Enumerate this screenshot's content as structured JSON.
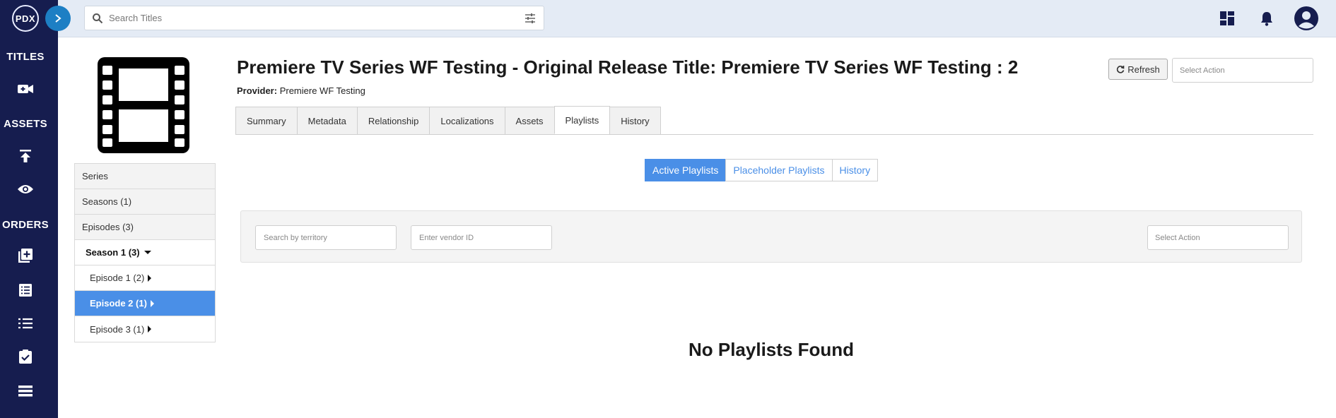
{
  "app": {
    "logo_text": "PDX"
  },
  "sidebar": {
    "sections": [
      {
        "heading": "TITLES"
      },
      {
        "heading": "ASSETS"
      },
      {
        "heading": "ORDERS"
      }
    ],
    "icons": [
      "video-camera-icon",
      "upload-icon",
      "eye-icon",
      "add-library-icon",
      "list-box-icon",
      "numbered-list-icon",
      "clipboard-check-icon",
      "table-list-icon"
    ]
  },
  "topbar": {
    "search_placeholder": "Search Titles",
    "icons": [
      "dashboard-icon",
      "bell-icon",
      "account-icon"
    ]
  },
  "header": {
    "title": "Premiere TV Series WF Testing - Original Release Title: Premiere TV Series WF Testing : 2",
    "provider_label": "Provider:",
    "provider_value": "Premiere WF Testing",
    "refresh_label": "Refresh",
    "select_action_placeholder": "Select Action"
  },
  "tree": {
    "items": [
      {
        "label": "Series"
      },
      {
        "label": "Seasons (1)"
      },
      {
        "label": "Episodes (3)"
      },
      {
        "label": "Season 1 (3)"
      },
      {
        "label": "Episode 1 (2)"
      },
      {
        "label": "Episode 2 (1)"
      },
      {
        "label": "Episode 3 (1)"
      }
    ]
  },
  "tabs": [
    {
      "label": "Summary"
    },
    {
      "label": "Metadata"
    },
    {
      "label": "Relationship"
    },
    {
      "label": "Localizations"
    },
    {
      "label": "Assets"
    },
    {
      "label": "Playlists",
      "active": true
    },
    {
      "label": "History"
    }
  ],
  "playlist_toggle": [
    {
      "label": "Active Playlists",
      "active": true
    },
    {
      "label": "Placeholder Playlists"
    },
    {
      "label": "History"
    }
  ],
  "filters": {
    "territory_placeholder": "Search by territory",
    "vendor_placeholder": "Enter vendor ID",
    "action_placeholder": "Select Action"
  },
  "empty_state": {
    "message": "No Playlists Found"
  },
  "colors": {
    "sidebar_bg": "#161d4f",
    "topbar_bg": "#e4ebf5",
    "accent": "#4a8fe7",
    "expand_button": "#1d7fc4"
  }
}
